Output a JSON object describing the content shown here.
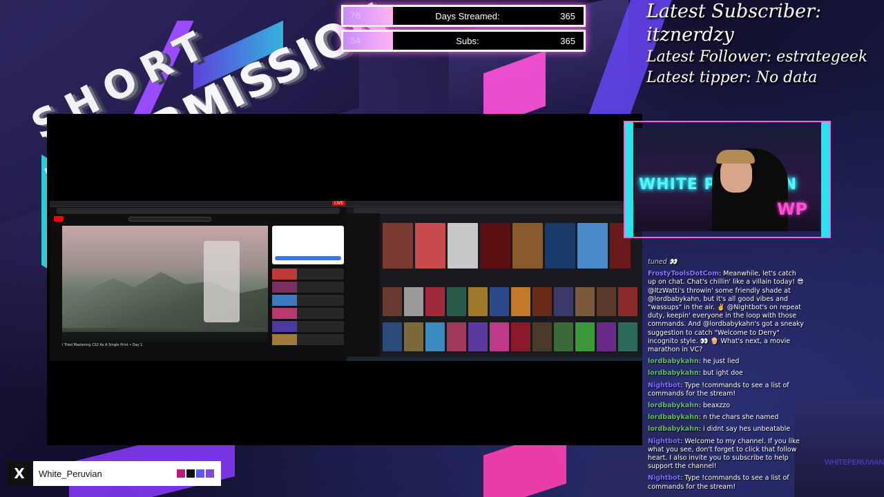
{
  "overlay": {
    "title_short": "SHORT",
    "title_main": "INTERMISSION"
  },
  "goals": [
    {
      "left_value": "76",
      "label": "Days Streamed:",
      "value": "365"
    },
    {
      "left_value": "54",
      "label": "Subs:",
      "value": "365"
    }
  ],
  "latest": {
    "subscriber_label": "Latest Subscriber:",
    "subscriber": "itznerdzy",
    "follower": "Latest Follower: estrategeek",
    "tipper": "Latest tipper: No data"
  },
  "webcam": {
    "sign": "WHITE PERUVIAN",
    "logo": "WP"
  },
  "screen": {
    "yt_live_badge": "LIVE",
    "yt_title": "I Tried Mastering CS2 As A Single Print • Day 1"
  },
  "chat": {
    "tuned": "tuned 👀",
    "messages": [
      {
        "user": "FrostyToolsDotCom",
        "type": "frosty",
        "text": "Meanwhile, let's catch up on chat. Chat's chillin' like a villain today! 😎 @ItzWatti's throwin' some friendly shade at @lordbabykahn, but it's all good vibes and \"wassups\" in the air. ✌️ @Nightbot's on repeat duty, keepin' everyone in the loop with those commands. And @lordbabykahn's got a sneaky suggestion to catch \"Welcome to Derry\" incognito style. 👀 🍿 What's next, a movie marathon in VC?"
      },
      {
        "user": "lordbabykahn",
        "type": "lord",
        "text": "he just lied"
      },
      {
        "user": "lordbabykahn",
        "type": "lord",
        "text": "but ight doe"
      },
      {
        "user": "Nightbot",
        "type": "night",
        "text": "Type !commands to see a list of commands for the stream!"
      },
      {
        "user": "lordbabykahn",
        "type": "lord",
        "text": "beaxzzo"
      },
      {
        "user": "lordbabykahn",
        "type": "lord",
        "text": "n the chars she named"
      },
      {
        "user": "lordbabykahn",
        "type": "lord",
        "text": "i didnt say hes unbeatable"
      },
      {
        "user": "Nightbot",
        "type": "night",
        "text": "Welcome to my channel. If you like what you see, don't forget to click that follow heart. I also invite you to subscribe to help support the channel!"
      },
      {
        "user": "Nightbot",
        "type": "night",
        "text": "Type !commands to see a list of commands for the stream!"
      }
    ]
  },
  "namebar": {
    "platform_icon": "X",
    "name": "White_Peruvian",
    "swatches": [
      "#c2187a",
      "#111111",
      "#5a57ff",
      "#7a4bd8"
    ]
  },
  "watermark": "WHITEPERUVIAN",
  "colors": {
    "accent_pink": "#ff5fe0",
    "accent_cyan": "#29e3ef"
  }
}
